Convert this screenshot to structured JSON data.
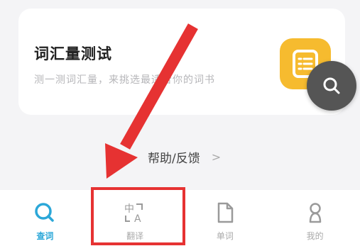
{
  "vocab_card": {
    "title": "词汇量测试",
    "subtitle": "测一测词汇量，来挑选最适合你的词书"
  },
  "help": {
    "label": "帮助/反馈",
    "chevron": ">"
  },
  "tabs": [
    {
      "label": "查词",
      "icon": "search-icon",
      "active": true
    },
    {
      "label": "翻译",
      "icon": "translate-icon",
      "active": false
    },
    {
      "label": "单词",
      "icon": "word-doc-icon",
      "active": false
    },
    {
      "label": "我的",
      "icon": "profile-icon",
      "active": false
    }
  ],
  "colors": {
    "active_tab": "#2ba7d8",
    "inactive_tab": "#aaaaaa",
    "card_icon_bg": "#f6bb2f",
    "annotation_red": "#e63232",
    "fab_bg": "#555555"
  }
}
